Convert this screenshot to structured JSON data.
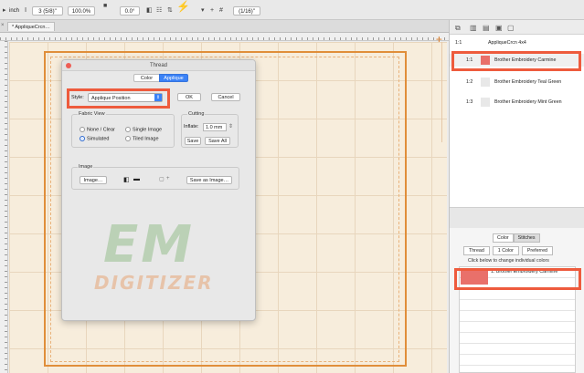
{
  "toolbar": {
    "unit": "inch",
    "size_value": "3 (5/8)\"",
    "zoom": "100.0%",
    "angle": "0.0°",
    "fraction": "(1/16)\""
  },
  "document": {
    "tab_label": "* AppliqueCrcn…"
  },
  "dialog": {
    "title": "Thread",
    "tabs": [
      "Color",
      "Applique"
    ],
    "active_tab": "Applique",
    "style_label": "Style:",
    "style_value": "Applique Position",
    "ok_label": "OK",
    "cancel_label": "Cancel",
    "fabric_view": {
      "title": "Fabric View",
      "options": [
        "None / Clear",
        "Single Image",
        "Simulated",
        "Tiled Image"
      ],
      "selected": "Simulated"
    },
    "cutting": {
      "title": "Cutting",
      "inflate_label": "Inflate:",
      "inflate_value": "1.0 mm",
      "save_label": "Save",
      "save_all_label": "Save All"
    },
    "image": {
      "title": "Image",
      "image_button": "Image…",
      "save_as_image": "Save as Image…"
    }
  },
  "watermark": {
    "em": "EM",
    "digitizer": "DIGITIZER"
  },
  "threads_panel": {
    "header_num": "1:1",
    "header_name": "AppliqueCrcn 4x4",
    "rows": [
      {
        "num": "1:1",
        "name": "Brother Embroidery Carmine",
        "color": "#e9706a",
        "highlighted": true
      },
      {
        "num": "1:2",
        "name": "Brother Embroidery Teal Green",
        "color": "#e8e8e8",
        "highlighted": false
      },
      {
        "num": "1:3",
        "name": "Brother Embroidery Mint Green",
        "color": "#e8e8e8",
        "highlighted": false
      }
    ]
  },
  "bottom_panel": {
    "tabs": [
      "Color",
      "Stitches"
    ],
    "active_tab": "Stitches",
    "segments": [
      "Thread",
      "1 Color",
      "Preferred"
    ],
    "hint": "Click below to change individual colors",
    "item": {
      "name": "1. Brother Embroidery Carmine",
      "color": "#e9706a"
    }
  },
  "colors": {
    "highlight": "#ee5b3d",
    "accent_blue": "#3b82f6",
    "hoop": "#e08e3a"
  }
}
